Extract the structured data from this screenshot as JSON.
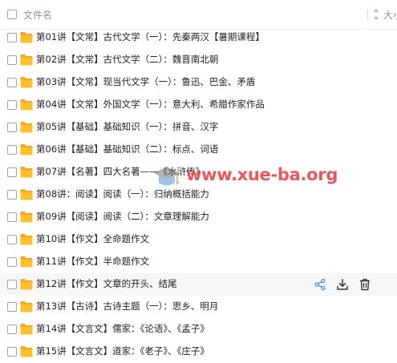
{
  "header": {
    "name_label": "文件名",
    "size_label": "大小"
  },
  "files": [
    {
      "name": "第01讲【文常】古代文学（一）：先秦两汉【暑期课程】"
    },
    {
      "name": "第02讲【文常】古代文学（二）：魏晋南北朝"
    },
    {
      "name": "第03讲【文常】现当代文学（一）：鲁迅、巴金、矛盾"
    },
    {
      "name": "第04讲【文常】外国文学（一）：意大利、希腊作家作品"
    },
    {
      "name": "第05讲【基础】基础知识（一）：拼音、汉字"
    },
    {
      "name": "第06讲【基础】基础知识（二）：标点、词语"
    },
    {
      "name": "第07讲【名著】四大名著——《水浒传》"
    },
    {
      "name": "第08讲：阅读】阅读（一）：归纳概括能力"
    },
    {
      "name": "第09讲【阅读】阅读（二）：文章理解能力"
    },
    {
      "name": "第10讲【作文】全命题作文"
    },
    {
      "name": "第11讲【作文】半命题作文"
    },
    {
      "name": "第12讲【作文】文章的开头、结尾"
    },
    {
      "name": "第13讲【古诗】古诗主题（一）：思乡、明月"
    },
    {
      "name": "第14讲【文言文】儒家：《论语》、《孟子》"
    },
    {
      "name": "第15讲【文言文】道家：《老子》、《庄子》"
    }
  ],
  "hovered_row_actions": [
    "share-icon",
    "download-icon",
    "delete-icon"
  ],
  "watermark": {
    "text": "www.xue-ba.org"
  },
  "colors": {
    "folder": "#ffc02e",
    "folder_dark": "#f5a623",
    "action_icon": "#4a90e2",
    "watermark": "#e83838",
    "hover_row": "#f5f7fb"
  }
}
